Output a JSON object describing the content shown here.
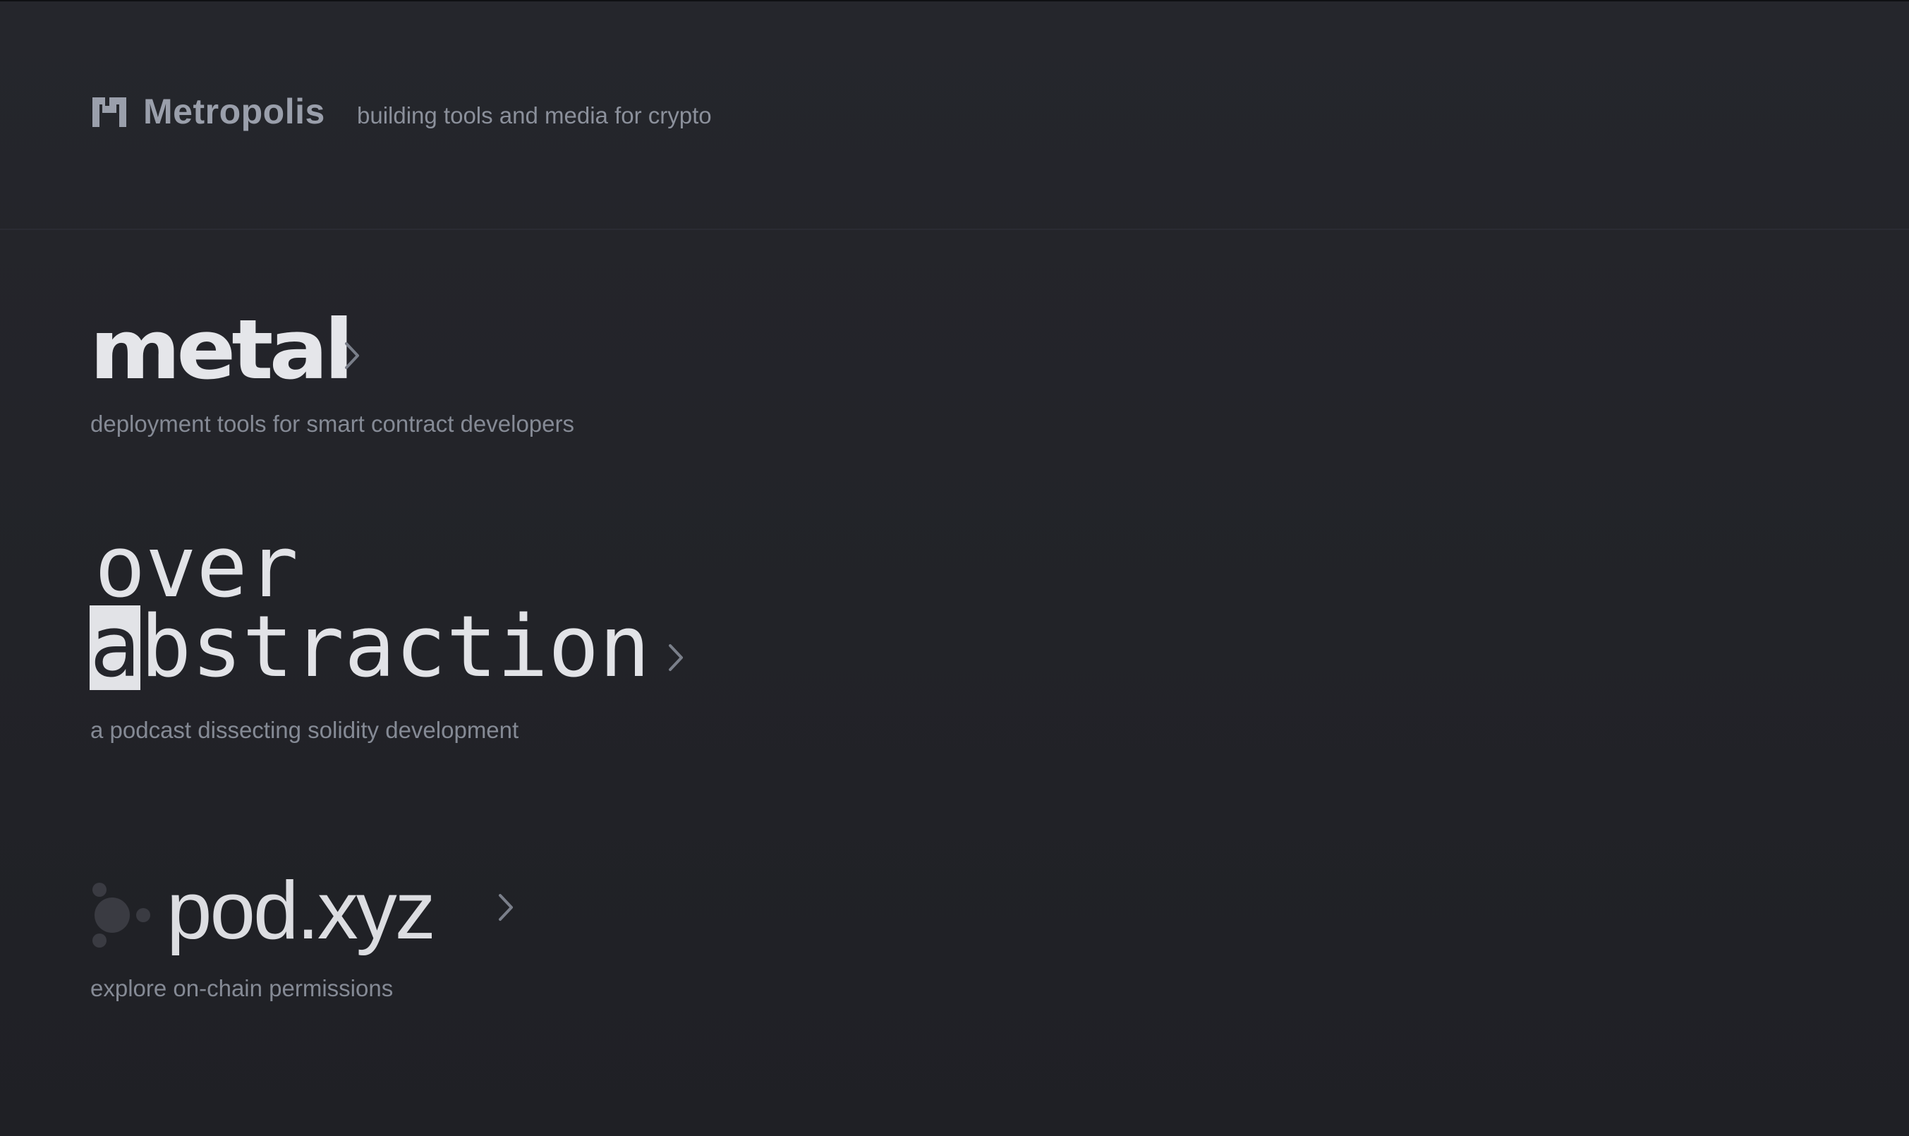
{
  "header": {
    "brand_name": "Metropolis",
    "tagline": "building tools and media for crypto",
    "logo_icon": "metropolis-m-logo-icon"
  },
  "projects": [
    {
      "title": "metal",
      "description": "deployment tools for smart contract developers",
      "arrow_icon": "chevron-right-icon"
    },
    {
      "title_line1": "over",
      "title_line2_highlight": "a",
      "title_line2_rest": "bstraction",
      "description": "a podcast dissecting solidity development",
      "arrow_icon": "chevron-right-icon"
    },
    {
      "title": "pod.xyz",
      "description": "explore on-chain permissions",
      "logo_icon": "pod-dots-logo-icon",
      "arrow_icon": "chevron-right-icon"
    }
  ],
  "colors": {
    "background": "#24252b",
    "title_text": "#e5e6ea",
    "muted_text": "#858a95",
    "chevron": "#7a7f8a"
  }
}
